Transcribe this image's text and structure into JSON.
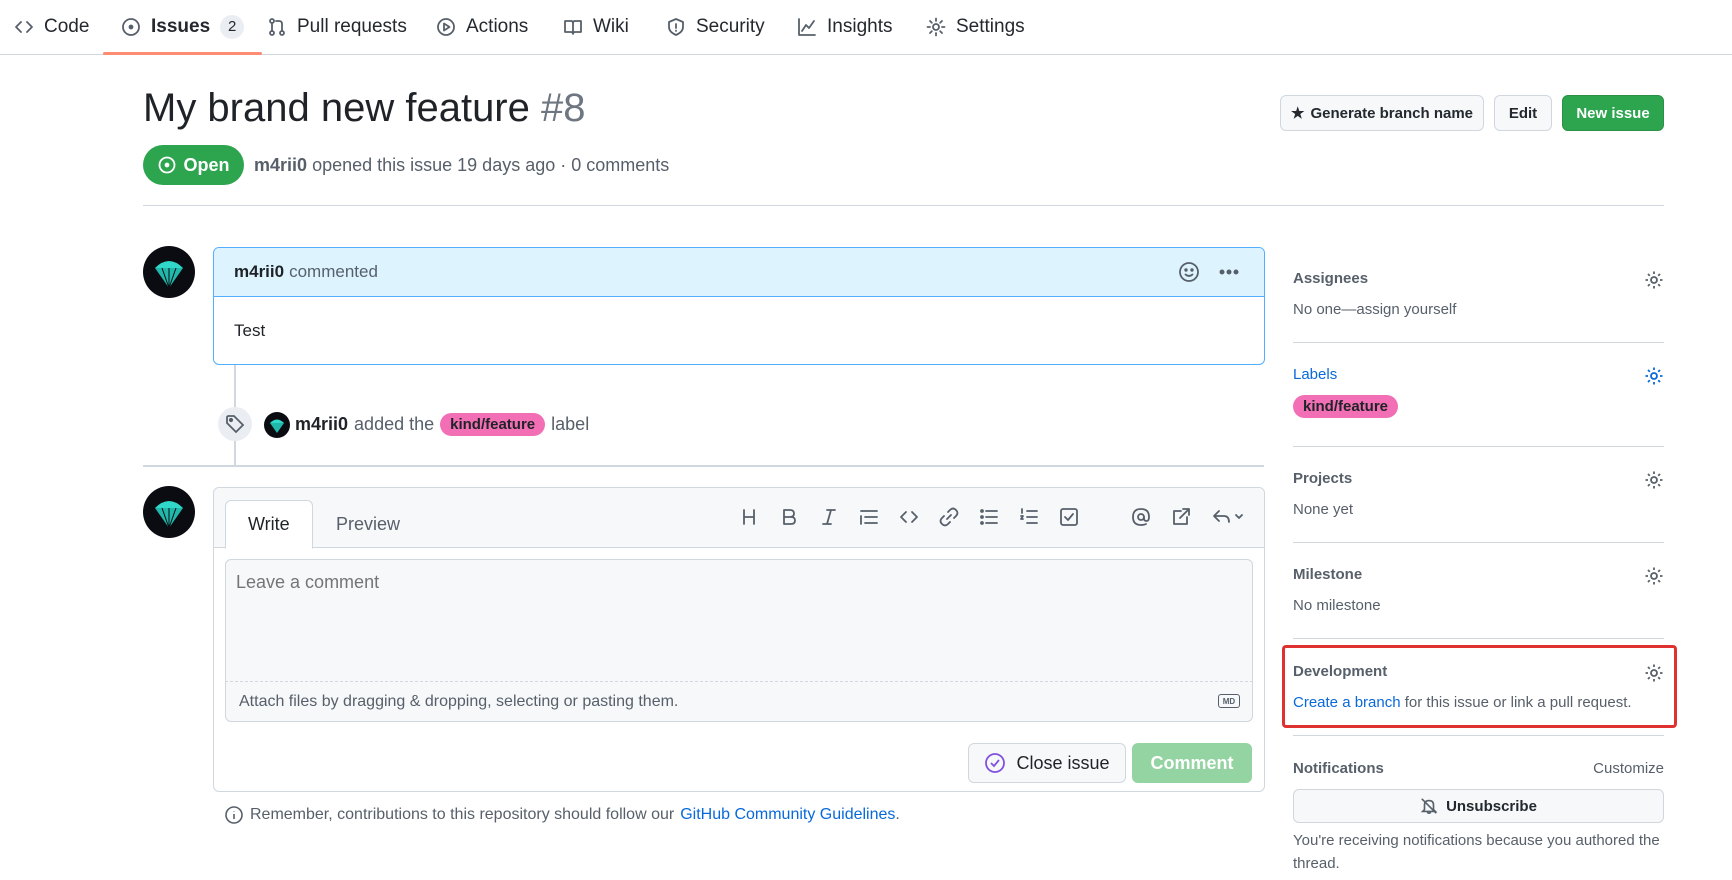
{
  "repo_nav": {
    "tabs": [
      {
        "label": "Code"
      },
      {
        "label": "Issues",
        "count": "2"
      },
      {
        "label": "Pull requests"
      },
      {
        "label": "Actions"
      },
      {
        "label": "Wiki"
      },
      {
        "label": "Security"
      },
      {
        "label": "Insights"
      },
      {
        "label": "Settings"
      }
    ]
  },
  "issue": {
    "title": "My brand new feature",
    "number": "#8",
    "state": "Open",
    "author": "m4rii0",
    "meta_text": "opened this issue 19 days ago · 0 comments"
  },
  "header_buttons": {
    "generate_branch": "Generate branch name",
    "edit": "Edit",
    "new_issue": "New issue"
  },
  "comment": {
    "author": "m4rii0",
    "action": "commented",
    "body": "Test"
  },
  "event": {
    "actor": "m4rii0",
    "text_before": "added the",
    "label": "kind/feature",
    "text_after": "label"
  },
  "editor": {
    "tab_write": "Write",
    "tab_preview": "Preview",
    "placeholder": "Leave a comment",
    "attach_text": "Attach files by dragging & dropping, selecting or pasting them.",
    "md_badge": "MD",
    "close_issue": "Close issue",
    "comment_button": "Comment"
  },
  "guidelines": {
    "prefix": "Remember, contributions to this repository should follow our",
    "link": "GitHub Community Guidelines",
    "suffix": "."
  },
  "sidebar": {
    "assignees": {
      "title": "Assignees",
      "value": "No one—assign yourself"
    },
    "labels": {
      "title": "Labels",
      "value": "kind/feature"
    },
    "projects": {
      "title": "Projects",
      "value": "None yet"
    },
    "milestone": {
      "title": "Milestone",
      "value": "No milestone"
    },
    "development": {
      "title": "Development",
      "link": "Create a branch",
      "suffix": "for this issue or link a pull request."
    },
    "notifications": {
      "title": "Notifications",
      "customize": "Customize",
      "button": "Unsubscribe",
      "text": "You're receiving notifications because you authored the thread."
    }
  },
  "colors": {
    "accent_green": "#2da44e",
    "link_blue": "#0969da",
    "label_pink": "#f26fb5",
    "highlight_red": "#e03131",
    "comment_header": "#ddf4ff"
  }
}
